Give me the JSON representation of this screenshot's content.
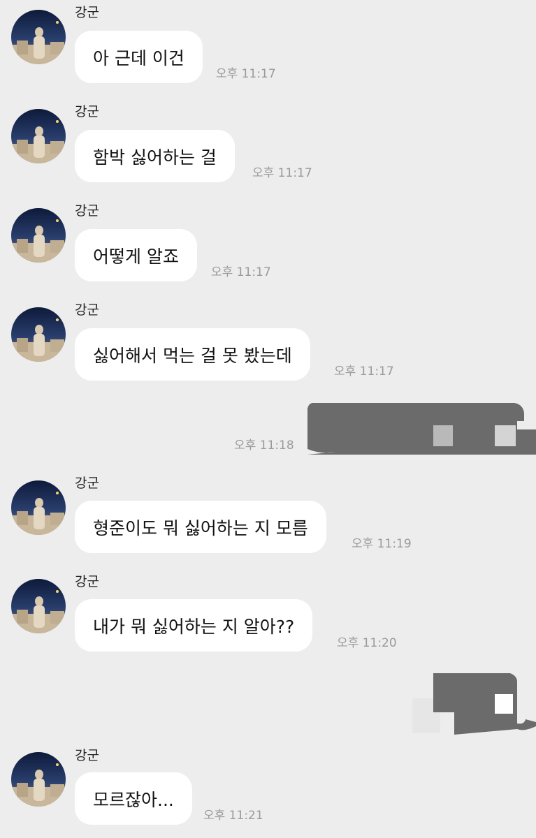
{
  "chat": {
    "messages": [
      {
        "sender": "강군",
        "text": "아 근데 이건",
        "time": "오후 11:17"
      },
      {
        "sender": "강군",
        "text": "함박 싫어하는 걸",
        "time": "오후 11:17"
      },
      {
        "sender": "강군",
        "text": "어떻게 알죠",
        "time": "오후 11:17"
      },
      {
        "sender": "강군",
        "text": "싫어해서 먹는 걸 못 봤는데",
        "time": "오후 11:17"
      },
      {
        "sender": "me",
        "text": "",
        "time": "오후 11:18"
      },
      {
        "sender": "강군",
        "text": "형준이도 뭐 싫어하는 지 모름",
        "time": "오후 11:19"
      },
      {
        "sender": "강군",
        "text": "내가 뭐 싫어하는 지 알아??",
        "time": "오후 11:20"
      },
      {
        "sender": "me",
        "text": "",
        "time": ""
      },
      {
        "sender": "강군",
        "text": "모르잖아...",
        "time": "오후 11:21"
      }
    ]
  },
  "colors": {
    "background": "#ededed",
    "incoming_bubble": "#ffffff",
    "redacted": "#6b6b6b",
    "timestamp": "#9a9a9a"
  },
  "icons": {
    "avatar": "profile-photo-avatar"
  }
}
